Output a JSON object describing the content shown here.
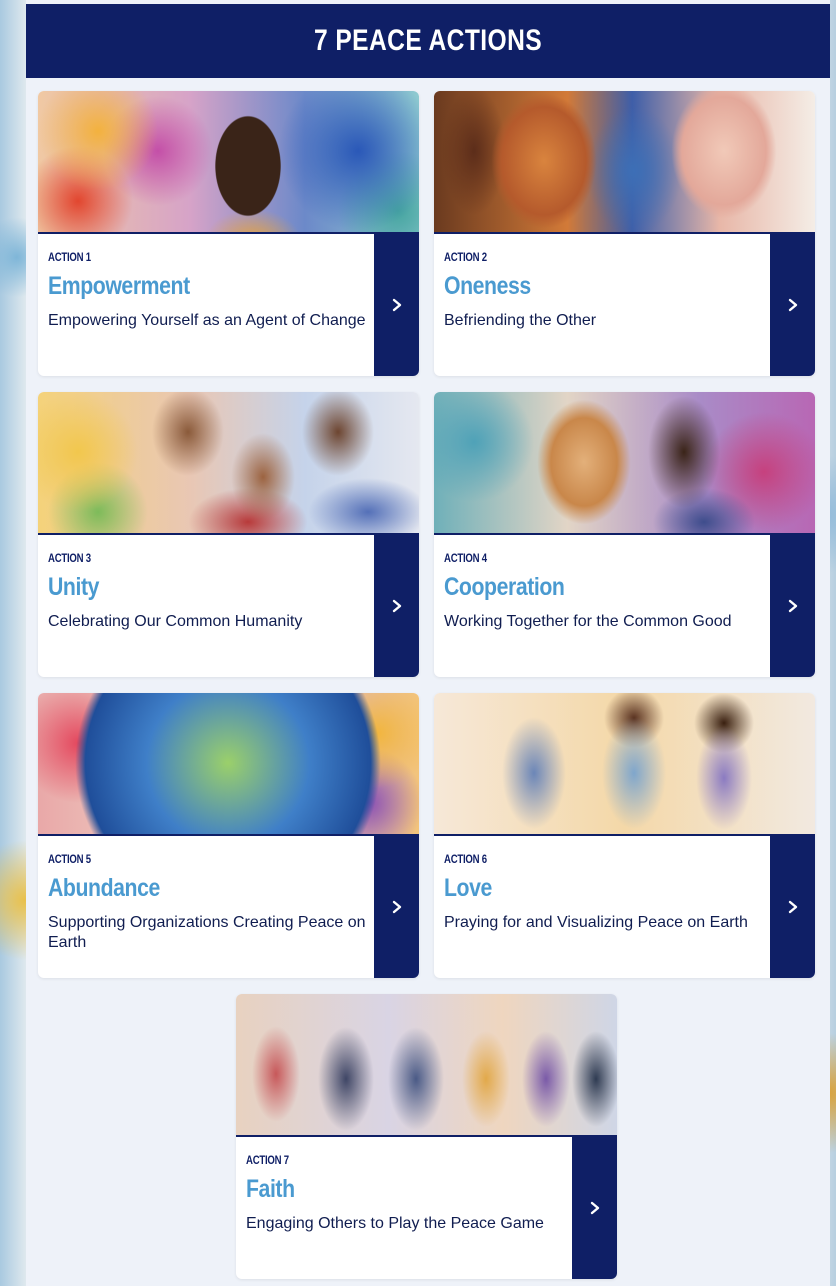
{
  "header": {
    "title": "7 PEACE ACTIONS"
  },
  "actions": [
    {
      "number": "ACTION 1",
      "title": "Empowerment",
      "description": "Empowering Yourself as an Agent of Change"
    },
    {
      "number": "ACTION 2",
      "title": "Oneness",
      "description": "Befriending the Other"
    },
    {
      "number": "ACTION 3",
      "title": "Unity",
      "description": "Celebrating Our Common Humanity"
    },
    {
      "number": "ACTION 4",
      "title": "Cooperation",
      "description": "Working Together for the Common Good"
    },
    {
      "number": "ACTION 5",
      "title": "Abundance",
      "description": "Supporting Organizations Creating Peace on Earth"
    },
    {
      "number": "ACTION 6",
      "title": "Love",
      "description": "Praying for and Visualizing Peace on Earth"
    },
    {
      "number": "ACTION 7",
      "title": "Faith",
      "description": "Engaging Others to Play the Peace Game"
    }
  ],
  "icons": {
    "arrow": "chevron-right-icon"
  },
  "colors": {
    "navy": "#0f1f66",
    "title_blue": "#4a9ad0",
    "background": "#eef2f9"
  }
}
